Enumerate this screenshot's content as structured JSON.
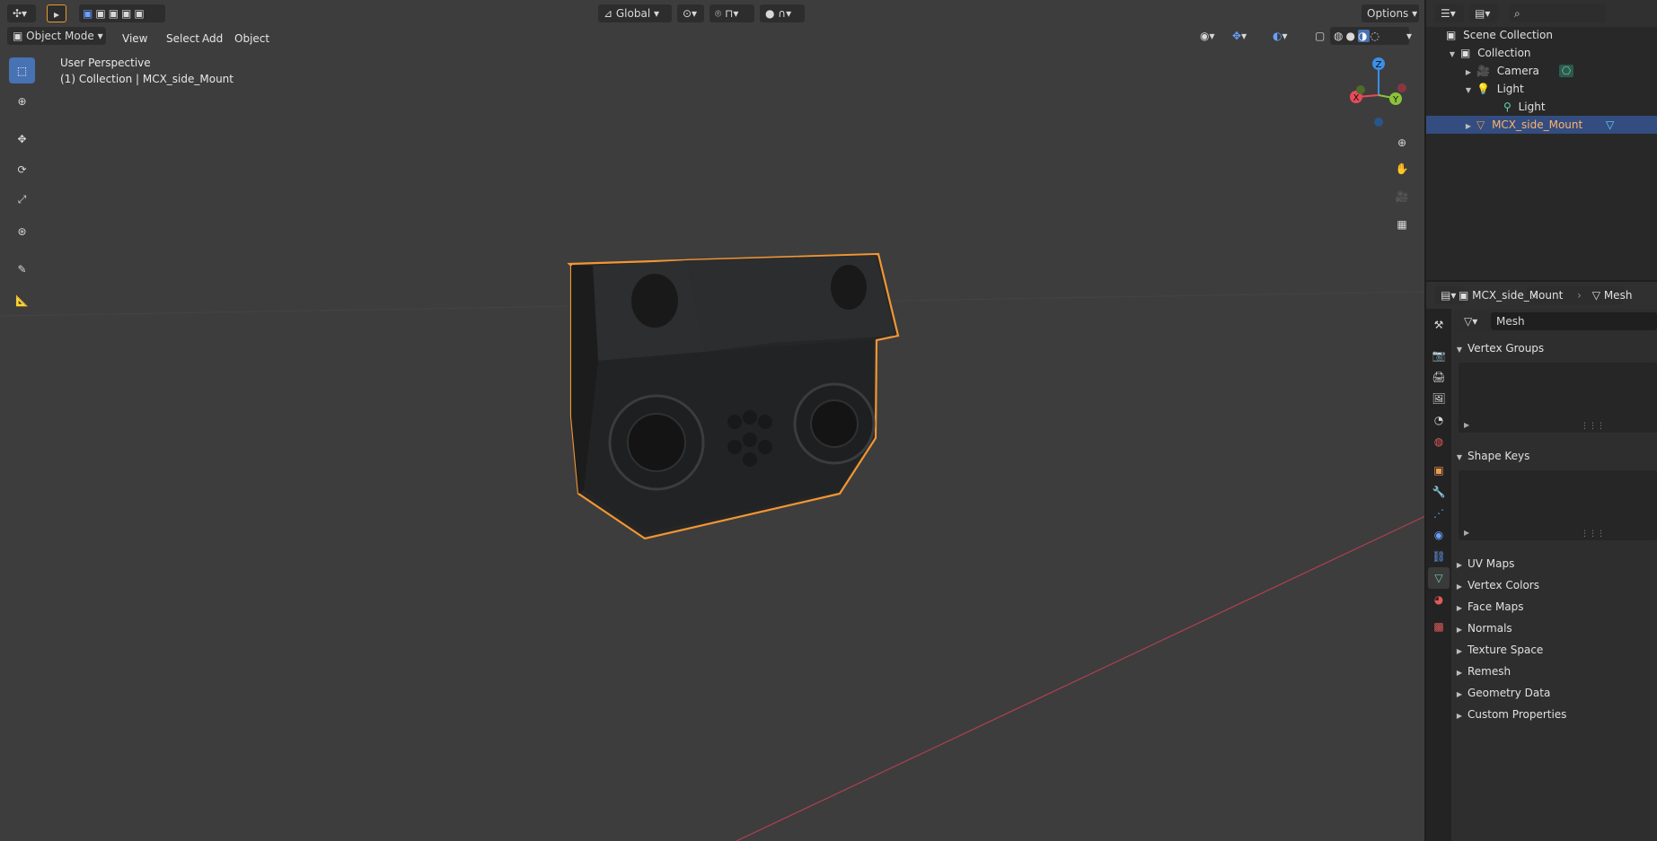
{
  "viewport": {
    "orientation_label": "Global",
    "options_label": "Options",
    "mode_label": "Object Mode",
    "menus": [
      "View",
      "Select",
      "Add",
      "Object"
    ],
    "overlay_line1": "User Perspective",
    "overlay_line2": "(1) Collection | MCX_side_Mount",
    "gizmo": {
      "z": "Z",
      "y": "Y",
      "x": "X"
    }
  },
  "outliner": {
    "root": "Scene Collection",
    "items": [
      {
        "label": "Collection"
      },
      {
        "label": "Camera"
      },
      {
        "label": "Light"
      },
      {
        "label": "Light"
      },
      {
        "label": "MCX_side_Mount"
      }
    ]
  },
  "properties": {
    "breadcrumb_object": "MCX_side_Mount",
    "breadcrumb_data": "Mesh",
    "mesh_name": "Mesh",
    "panels_open": [
      "Vertex Groups",
      "Shape Keys"
    ],
    "panels_closed": [
      "UV Maps",
      "Vertex Colors",
      "Face Maps",
      "Normals",
      "Texture Space",
      "Remesh",
      "Geometry Data",
      "Custom Properties"
    ]
  },
  "colors": {
    "selection": "#4772b3",
    "outline": "#f5952b",
    "axis_x": "#e94a5a",
    "axis_y": "#8bc33a",
    "axis_z": "#3b8fe8"
  }
}
